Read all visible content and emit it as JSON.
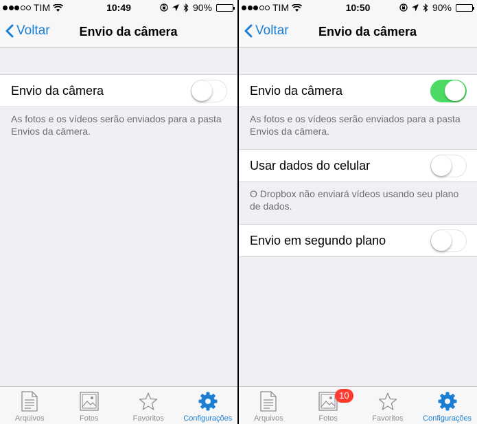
{
  "colors": {
    "accent": "#1a7ed4",
    "toggle_on": "#4cd964",
    "badge": "#ff3b30"
  },
  "status": {
    "carrier": "TIM",
    "battery": "90%"
  },
  "left": {
    "status_time": "10:49",
    "nav": {
      "back_label": "Voltar",
      "title": "Envio da câmera"
    },
    "sections": [
      {
        "label": "Envio da câmera",
        "on": false,
        "footer": "As fotos e os vídeos serão enviados para a pasta Envios da câmera."
      }
    ]
  },
  "right": {
    "status_time": "10:50",
    "nav": {
      "back_label": "Voltar",
      "title": "Envio da câmera"
    },
    "sections": [
      {
        "label": "Envio da câmera",
        "on": true,
        "footer": "As fotos e os vídeos serão enviados para a pasta Envios da câmera."
      },
      {
        "label": "Usar dados do celular",
        "on": false,
        "footer": "O Dropbox não enviará vídeos usando seu plano de dados."
      },
      {
        "label": "Envio em segundo plano",
        "on": false
      }
    ]
  },
  "tabs": [
    {
      "label": "Arquivos",
      "icon": "document-icon"
    },
    {
      "label": "Fotos",
      "icon": "photo-icon"
    },
    {
      "label": "Favoritos",
      "icon": "star-icon"
    },
    {
      "label": "Configurações",
      "icon": "gear-icon"
    }
  ],
  "right_tabs_badge": "10"
}
